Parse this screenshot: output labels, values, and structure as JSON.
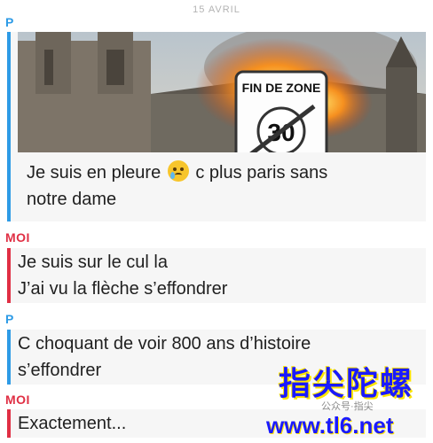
{
  "header": {
    "date": "15 AVRIL"
  },
  "messages": [
    {
      "sender": "P",
      "photo": {
        "sign_text_top": "FIN DE ZONE",
        "sign_number": "30"
      },
      "lines": [
        "Je suis en pleure",
        "c plus paris sans",
        "notre dame"
      ],
      "emoji": "crying-face-icon"
    },
    {
      "sender": "MOI",
      "lines": [
        "Je suis sur le cul la",
        "J’ai vu la flèche s’effondrer"
      ]
    },
    {
      "sender": "P",
      "lines": [
        "C choquant de voir 800 ans d’histoire",
        "s’effondrer"
      ]
    },
    {
      "sender": "MOI",
      "lines": [
        "Exactement..."
      ]
    }
  ],
  "watermark": {
    "chars": "指尖陀螺",
    "url": "www.tl6.net",
    "sub": "公众号·指尖"
  },
  "colors": {
    "friend": "#2e9be6",
    "me": "#e02f44",
    "bubble_bg": "#f6f6f6"
  }
}
